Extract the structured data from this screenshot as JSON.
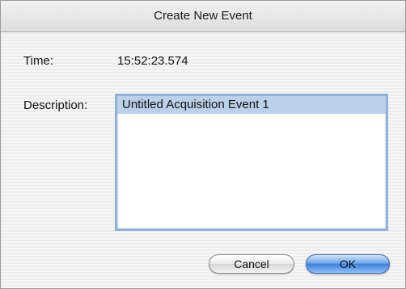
{
  "dialog": {
    "title": "Create New Event"
  },
  "form": {
    "time_label": "Time:",
    "time_value": "15:52:23.574",
    "description_label": "Description:",
    "description_value": "Untitled Acquisition Event 1"
  },
  "buttons": {
    "cancel_label": "Cancel",
    "ok_label": "OK"
  },
  "colors": {
    "selection_highlight": "#bcd0ea",
    "focus_ring": "#8fb2dc",
    "default_button": "#3d82dc"
  }
}
